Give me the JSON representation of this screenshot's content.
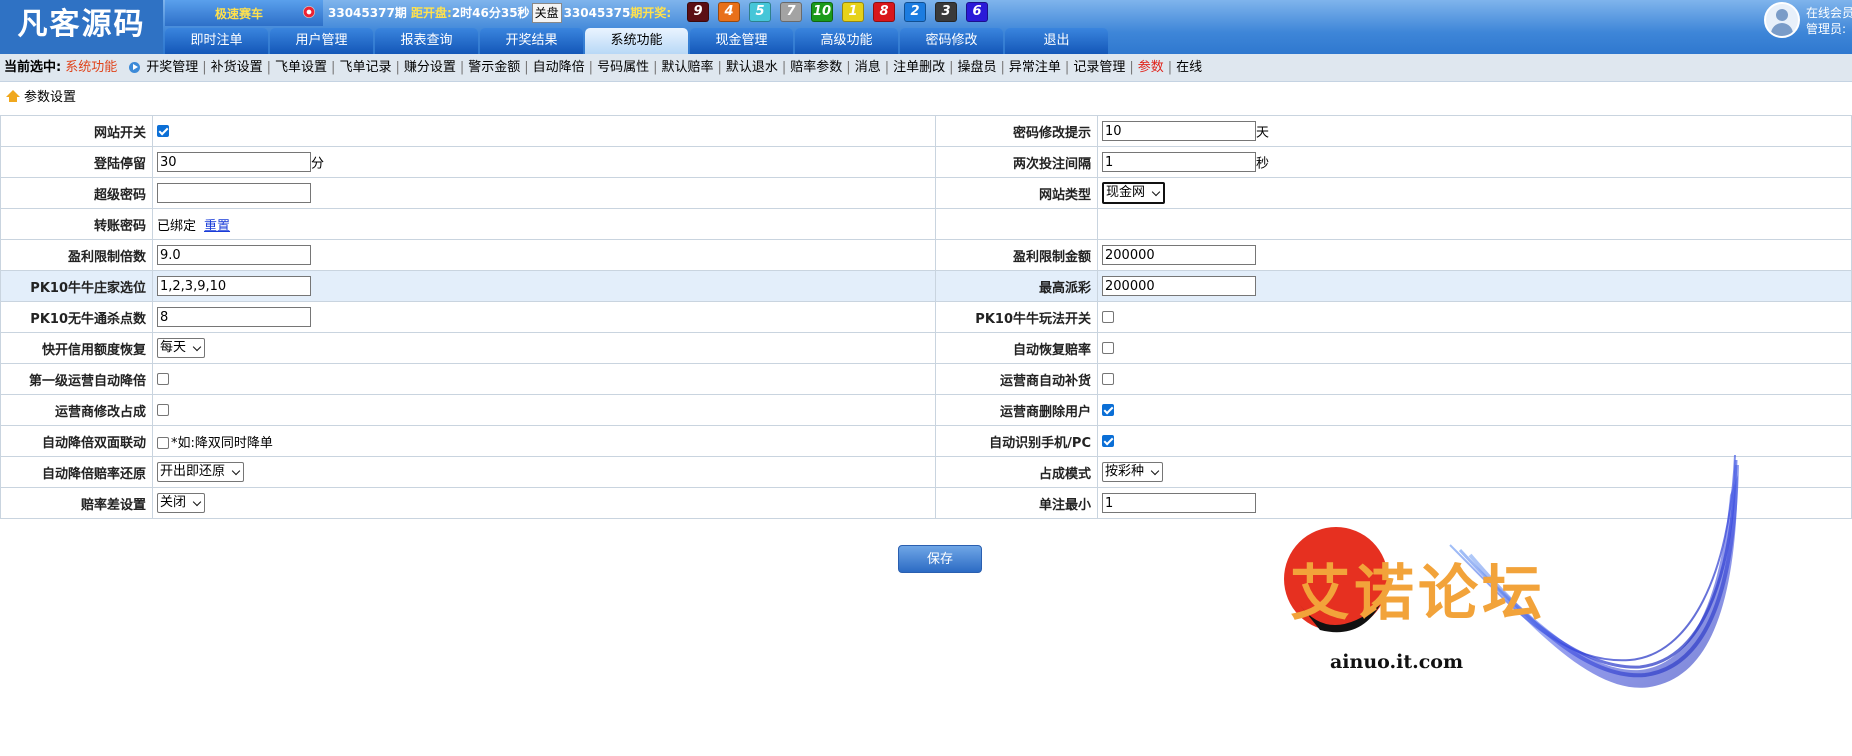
{
  "app": {
    "logo": "凡客源码"
  },
  "game": {
    "name": "极速赛车"
  },
  "period": {
    "current": "33045377期",
    "countdown_label": "距开盘:",
    "countdown": "2时46分35秒",
    "close_button": "关盘",
    "last": "33045375",
    "last_label": "期开奖:"
  },
  "balls": [
    {
      "n": "9",
      "color": "#5b0f14"
    },
    {
      "n": "4",
      "color": "#e8701a"
    },
    {
      "n": "5",
      "color": "#46c6d8"
    },
    {
      "n": "7",
      "color": "#a3a3a3"
    },
    {
      "n": "10",
      "color": "#1b9a1b"
    },
    {
      "n": "1",
      "color": "#e6d21a"
    },
    {
      "n": "8",
      "color": "#d9161c"
    },
    {
      "n": "2",
      "color": "#1c7ce0"
    },
    {
      "n": "3",
      "color": "#3a3a3a"
    },
    {
      "n": "6",
      "color": "#2a1ad8"
    }
  ],
  "nav": {
    "tabs": [
      "即时注单",
      "用户管理",
      "报表查询",
      "开奖结果",
      "系统功能",
      "现金管理",
      "高级功能",
      "密码修改",
      "退出"
    ],
    "active_index": 4
  },
  "user": {
    "line1": "在线会员",
    "line2": "管理员:"
  },
  "subnav": {
    "current_label": "当前选中:",
    "current_value": "系统功能",
    "items": [
      "开奖管理",
      "补货设置",
      "飞单设置",
      "飞单记录",
      "赚分设置",
      "警示金额",
      "自动降倍",
      "号码属性",
      "默认赔率",
      "默认退水",
      "赔率参数",
      "消息",
      "注单删改",
      "操盘员",
      "异常注单",
      "记录管理",
      "参数",
      "在线"
    ],
    "active_item": "参数"
  },
  "breadcrumb": "参数设置",
  "form": {
    "rows": [
      {
        "left": {
          "label": "网站开关",
          "type": "checkbox",
          "checked": true
        },
        "right": {
          "label": "密码修改提示",
          "type": "text",
          "value": "10",
          "unit": "天"
        }
      },
      {
        "left": {
          "label": "登陆停留",
          "type": "text",
          "value": "30",
          "unit": "分"
        },
        "right": {
          "label": "两次投注间隔",
          "type": "text",
          "value": "1",
          "unit": "秒"
        }
      },
      {
        "left": {
          "label": "超级密码",
          "type": "text",
          "value": ""
        },
        "right": {
          "label": "网站类型",
          "type": "select",
          "value": "现金网",
          "focus": true
        }
      },
      {
        "left": {
          "label": "转账密码",
          "type": "static",
          "value": "已绑定",
          "link": "重置"
        },
        "right": {
          "label": "",
          "type": "empty"
        }
      },
      {
        "left": {
          "label": "盈利限制倍数",
          "type": "text",
          "value": "9.0"
        },
        "right": {
          "label": "盈利限制金额",
          "type": "text",
          "value": "200000"
        }
      },
      {
        "left": {
          "label": "PK10牛牛庄家选位",
          "type": "text",
          "value": "1,2,3,9,10"
        },
        "right": {
          "label": "最高派彩",
          "type": "text",
          "value": "200000"
        },
        "highlight": true
      },
      {
        "left": {
          "label": "PK10无牛通杀点数",
          "type": "text",
          "value": "8"
        },
        "right": {
          "label": "PK10牛牛玩法开关",
          "type": "checkbox",
          "checked": false
        }
      },
      {
        "left": {
          "label": "快开信用额度恢复",
          "type": "select",
          "value": "每天"
        },
        "right": {
          "label": "自动恢复赔率",
          "type": "checkbox",
          "checked": false
        }
      },
      {
        "left": {
          "label": "第一级运营自动降倍",
          "type": "checkbox",
          "checked": false
        },
        "right": {
          "label": "运营商自动补货",
          "type": "checkbox",
          "checked": false
        }
      },
      {
        "left": {
          "label": "运营商修改占成",
          "type": "checkbox",
          "checked": false
        },
        "right": {
          "label": "运营商删除用户",
          "type": "checkbox",
          "checked": true
        }
      },
      {
        "left": {
          "label": "自动降倍双面联动",
          "type": "checkbox",
          "checked": false,
          "hint": "*如:降双同时降单"
        },
        "right": {
          "label": "自动识别手机/PC",
          "type": "checkbox",
          "checked": true
        }
      },
      {
        "left": {
          "label": "自动降倍赔率还原",
          "type": "select",
          "value": "开出即还原"
        },
        "right": {
          "label": "占成模式",
          "type": "select",
          "value": "按彩种"
        }
      },
      {
        "left": {
          "label": "赔率差设置",
          "type": "select",
          "value": "关闭"
        },
        "right": {
          "label": "单注最小",
          "type": "text",
          "value": "1"
        }
      }
    ],
    "save_label": "保存"
  },
  "watermark": {
    "text": "艾诺论坛",
    "url": "ainuo.it.com"
  }
}
